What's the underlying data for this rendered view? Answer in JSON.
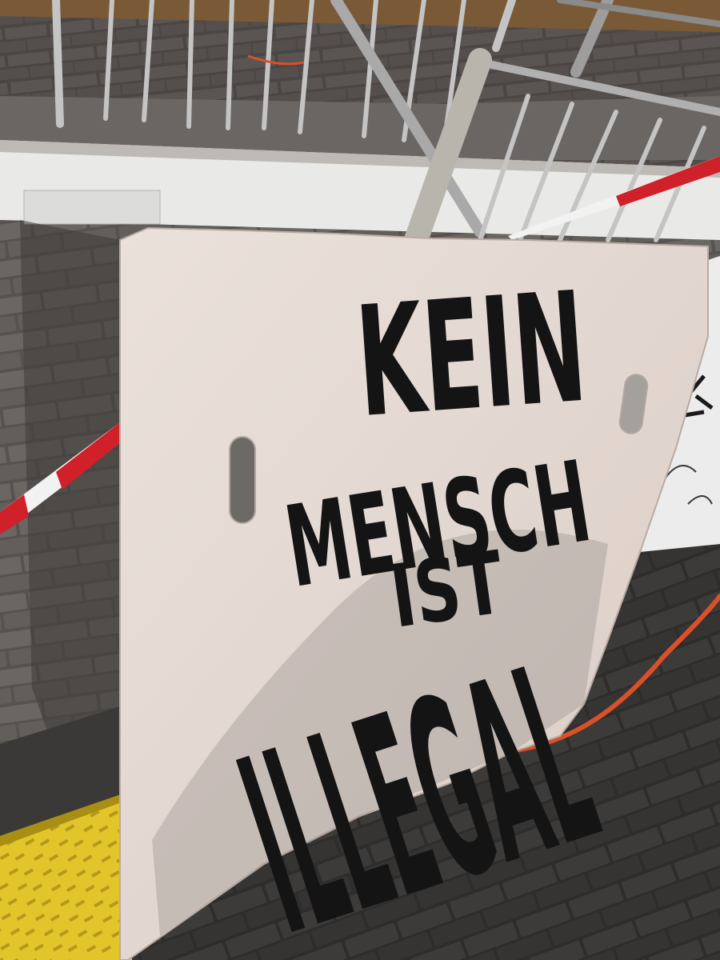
{
  "sign": {
    "line1": "KEIN",
    "line2": "MENSCH",
    "line3": "IST",
    "line4": "ILLEGAL"
  },
  "colors": {
    "cardboard": "#e6dad4",
    "ink": "#141414",
    "pavement": "#5c5a58",
    "warning_tape_red": "#d0202a",
    "warning_tape_white": "#f2f2f2",
    "ramp_yellow": "#e2c52a",
    "cable_orange": "#e0562a",
    "railing_metal": "#b8b8b8"
  }
}
